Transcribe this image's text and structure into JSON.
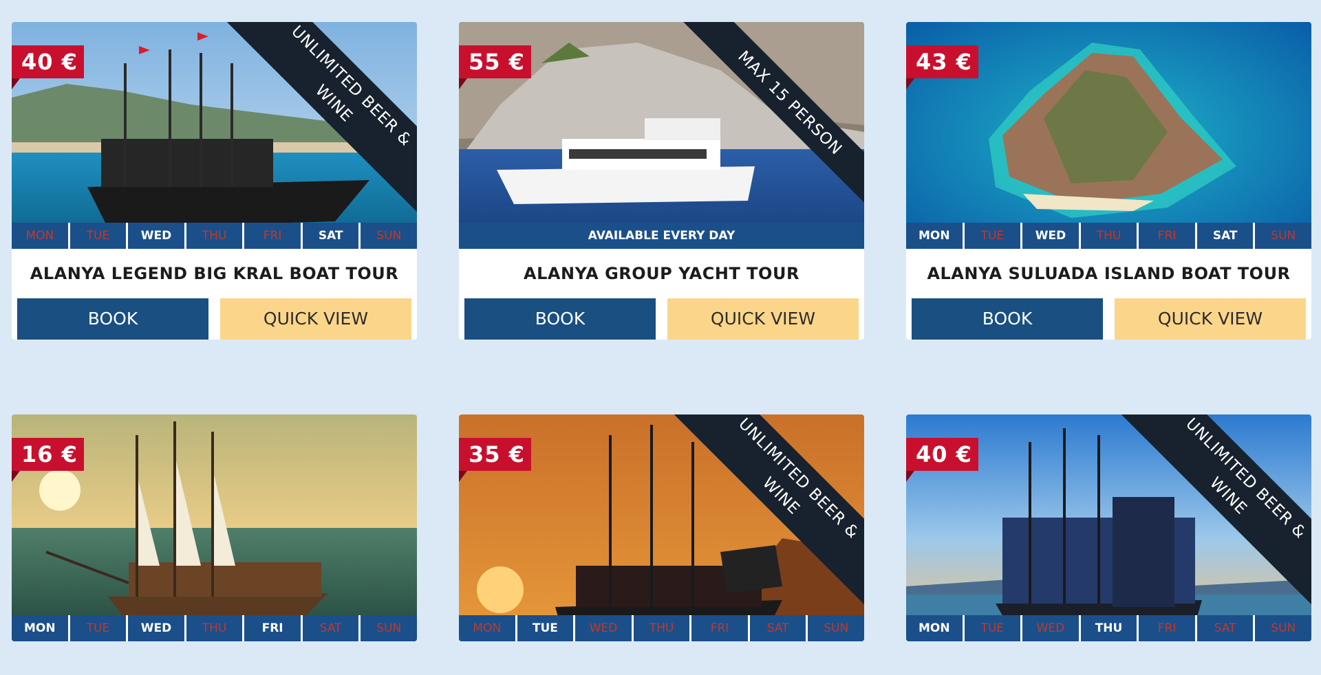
{
  "tours": [
    {
      "price": "40 €",
      "ribbon": [
        "UNLIMITED BEER &",
        "WINE"
      ],
      "days": [
        {
          "label": "MON",
          "available": false
        },
        {
          "label": "TUE",
          "available": false
        },
        {
          "label": "WED",
          "available": true
        },
        {
          "label": "THU",
          "available": false
        },
        {
          "label": "FRI",
          "available": false
        },
        {
          "label": "SAT",
          "available": true
        },
        {
          "label": "SUN",
          "available": false
        }
      ],
      "title": "ALANYA LEGEND BIG KRAL BOAT TOUR",
      "book_label": "BOOK",
      "quick_label": "QUICK VIEW"
    },
    {
      "price": "55 €",
      "ribbon": [
        "MAX 15 PERSON"
      ],
      "availability_text": "AVAILABLE EVERY DAY",
      "title": "ALANYA GROUP YACHT TOUR",
      "book_label": "BOOK",
      "quick_label": "QUICK VIEW"
    },
    {
      "price": "43 €",
      "days": [
        {
          "label": "MON",
          "available": true
        },
        {
          "label": "TUE",
          "available": false
        },
        {
          "label": "WED",
          "available": true
        },
        {
          "label": "THU",
          "available": false
        },
        {
          "label": "FRI",
          "available": false
        },
        {
          "label": "SAT",
          "available": true
        },
        {
          "label": "SUN",
          "available": false
        }
      ],
      "title": "ALANYA SULUADA ISLAND BOAT TOUR",
      "book_label": "BOOK",
      "quick_label": "QUICK VIEW"
    },
    {
      "price": "16 €",
      "days": [
        {
          "label": "MON",
          "available": true
        },
        {
          "label": "TUE",
          "available": false
        },
        {
          "label": "WED",
          "available": true
        },
        {
          "label": "THU",
          "available": false
        },
        {
          "label": "FRI",
          "available": true
        },
        {
          "label": "SAT",
          "available": false
        },
        {
          "label": "SUN",
          "available": false
        }
      ]
    },
    {
      "price": "35 €",
      "ribbon": [
        "UNLIMITED BEER &",
        "WINE"
      ],
      "days": [
        {
          "label": "MON",
          "available": false
        },
        {
          "label": "TUE",
          "available": true
        },
        {
          "label": "WED",
          "available": false
        },
        {
          "label": "THU",
          "available": false
        },
        {
          "label": "FRI",
          "available": false
        },
        {
          "label": "SAT",
          "available": false
        },
        {
          "label": "SUN",
          "available": false
        }
      ]
    },
    {
      "price": "40 €",
      "ribbon": [
        "UNLIMITED BEER &",
        "WINE"
      ],
      "days": [
        {
          "label": "MON",
          "available": true
        },
        {
          "label": "TUE",
          "available": false
        },
        {
          "label": "WED",
          "available": false
        },
        {
          "label": "THU",
          "available": true
        },
        {
          "label": "FRI",
          "available": false
        },
        {
          "label": "SAT",
          "available": false
        },
        {
          "label": "SUN",
          "available": false
        }
      ]
    }
  ]
}
